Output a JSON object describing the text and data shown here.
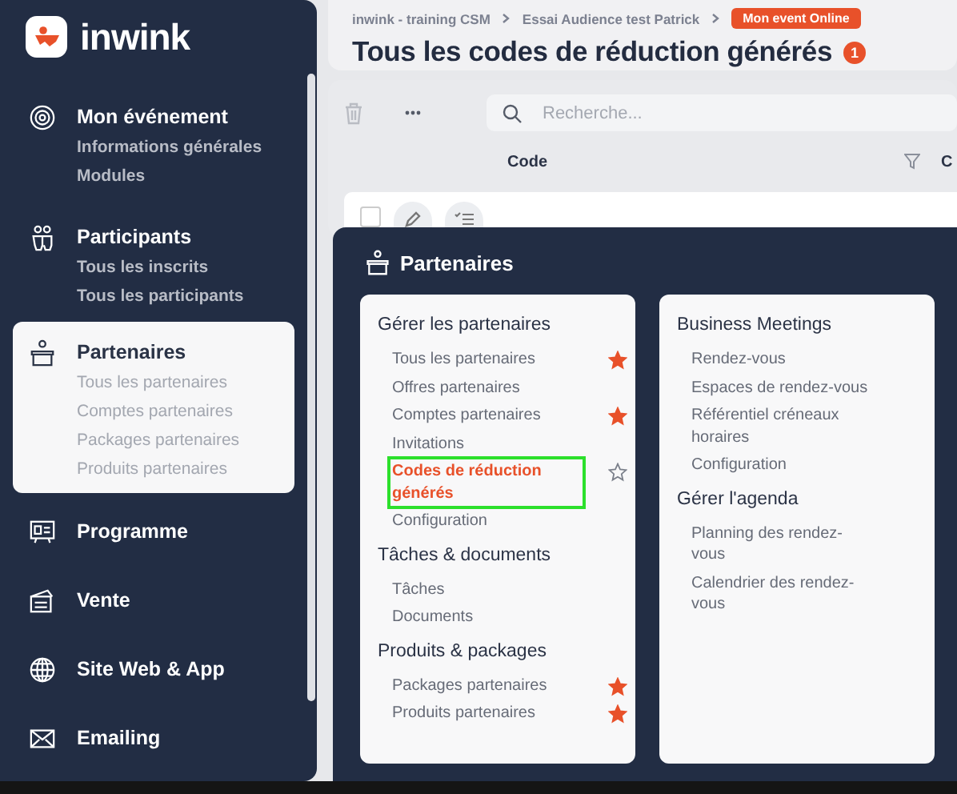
{
  "brand": {
    "name": "inwink"
  },
  "sidebar": {
    "sections": [
      {
        "title": "Mon événement",
        "selected": false,
        "items": [
          "Informations générales",
          "Modules"
        ]
      },
      {
        "title": "Participants",
        "selected": false,
        "items": [
          "Tous les inscrits",
          "Tous les participants"
        ]
      },
      {
        "title": "Partenaires",
        "selected": true,
        "items": [
          "Tous les partenaires",
          "Comptes partenaires",
          "Packages partenaires",
          "Produits partenaires"
        ]
      },
      {
        "title": "Programme",
        "selected": false
      },
      {
        "title": "Vente",
        "selected": false
      },
      {
        "title": "Site Web & App",
        "selected": false
      },
      {
        "title": "Emailing",
        "selected": false
      }
    ]
  },
  "breadcrumb": [
    "inwink - training CSM",
    "Essai Audience test Patrick"
  ],
  "event_status": "Mon event Online",
  "page_title": "Tous les codes de réduction générés",
  "title_badge": "1",
  "search": {
    "placeholder": "Recherche..."
  },
  "table": {
    "columns": [
      "Code",
      "C"
    ],
    "rows": [
      {
        "checked": false
      }
    ]
  },
  "menu": {
    "title": "Partenaires",
    "columns": [
      {
        "groups": [
          {
            "title": "Gérer les partenaires",
            "items": [
              {
                "label": "Tous les partenaires",
                "selected": false,
                "favorite": true
              },
              {
                "label": "Offres partenaires",
                "selected": false
              },
              {
                "label": "Comptes partenaires",
                "selected": false,
                "favorite": true
              },
              {
                "label": "Invitations",
                "selected": false
              },
              {
                "label": "Codes de réduction générés",
                "selected": true,
                "highlighted": true,
                "favorite": false
              },
              {
                "label": "Configuration",
                "selected": false
              }
            ]
          },
          {
            "title": "Tâches & documents",
            "items": [
              {
                "label": "Tâches",
                "selected": false
              },
              {
                "label": "Documents",
                "selected": false
              }
            ]
          },
          {
            "title": "Produits & packages",
            "items": [
              {
                "label": "Packages partenaires",
                "selected": false,
                "favorite": true
              },
              {
                "label": "Produits partenaires",
                "selected": false,
                "favorite": true
              }
            ]
          }
        ]
      },
      {
        "groups": [
          {
            "title": "Business Meetings",
            "items": [
              {
                "label": "Rendez-vous",
                "selected": false
              },
              {
                "label": "Espaces de rendez-vous",
                "selected": false
              },
              {
                "label": "Référentiel créneaux horaires",
                "selected": false
              },
              {
                "label": "Configuration",
                "selected": false
              }
            ]
          },
          {
            "title": "Gérer l'agenda",
            "items": [
              {
                "label": "Planning des rendez-vous",
                "selected": false
              },
              {
                "label": "Calendrier des rendez-vous",
                "selected": false
              }
            ]
          }
        ]
      }
    ]
  }
}
